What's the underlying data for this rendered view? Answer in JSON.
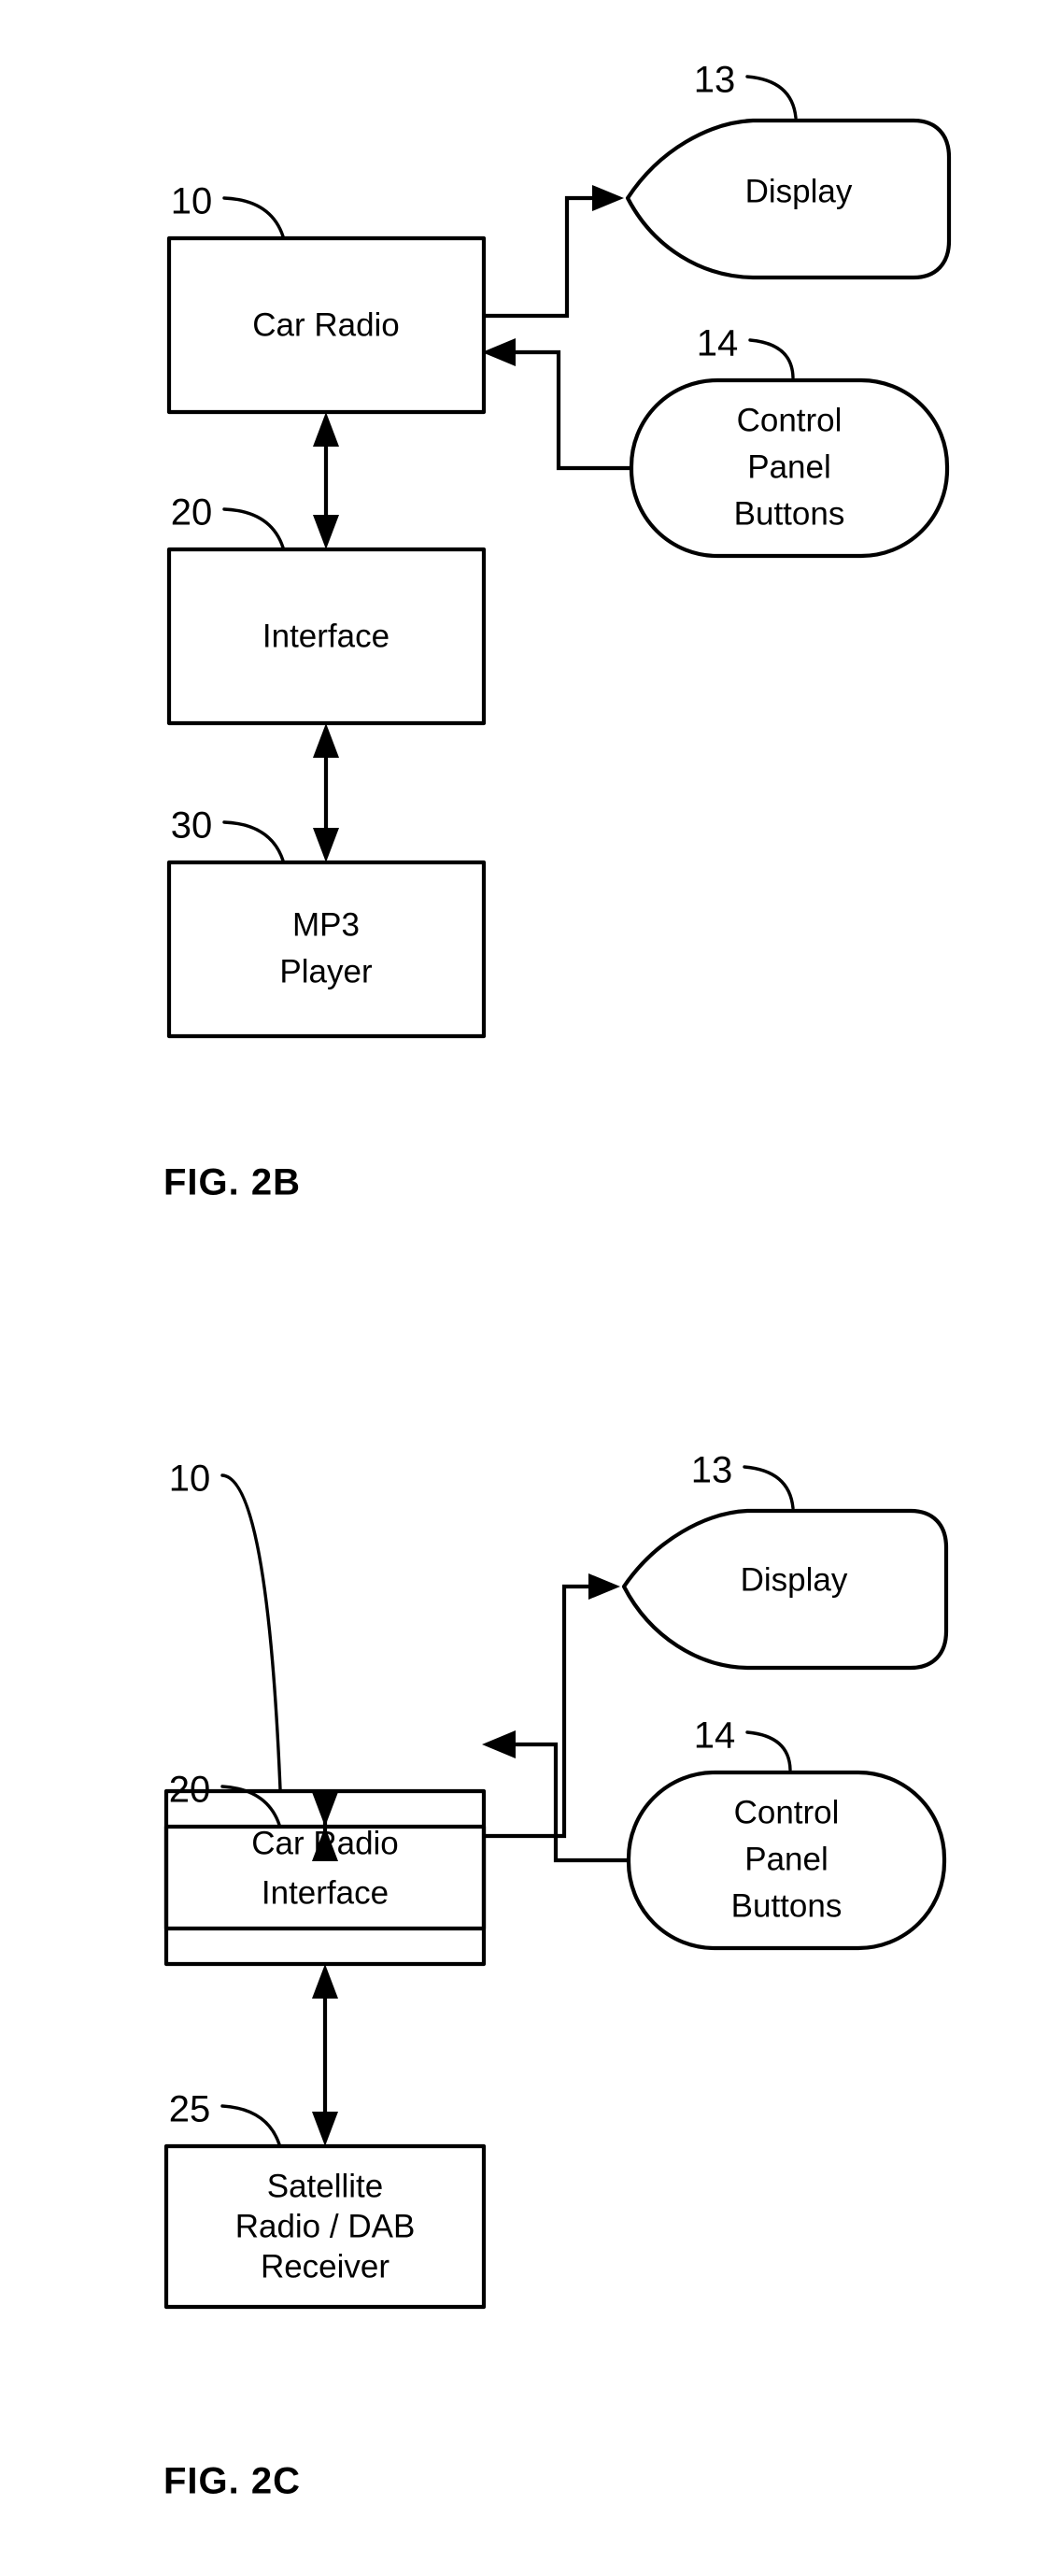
{
  "document": {
    "type": "patent-drawing-sheet",
    "background_color": "#ffffff",
    "ink_color": "#000000",
    "figure_count": 2
  },
  "figures": [
    {
      "id": "fig-2b",
      "caption": "FIG. 2B",
      "nodes": [
        {
          "key": "car_radio",
          "label": "Car Radio",
          "ref": "10",
          "shape": "rectangle"
        },
        {
          "key": "display",
          "label": "Display",
          "ref": "13",
          "shape": "teardrop"
        },
        {
          "key": "control_panel",
          "label_lines": [
            "Control",
            "Panel",
            "Buttons"
          ],
          "ref": "14",
          "shape": "rounded-rectangle"
        },
        {
          "key": "interface",
          "label": "Interface",
          "ref": "20",
          "shape": "rectangle"
        },
        {
          "key": "mp3_player",
          "label_lines": [
            "MP3",
            "Player"
          ],
          "ref": "30",
          "shape": "rectangle"
        }
      ],
      "connections": [
        {
          "from": "car_radio",
          "to": "display",
          "direction": "one-way"
        },
        {
          "from": "control_panel",
          "to": "car_radio",
          "direction": "one-way"
        },
        {
          "from": "car_radio",
          "to": "interface",
          "direction": "two-way"
        },
        {
          "from": "interface",
          "to": "mp3_player",
          "direction": "two-way"
        }
      ]
    },
    {
      "id": "fig-2c",
      "caption": "FIG. 2C",
      "nodes": [
        {
          "key": "car_radio",
          "label": "Car Radio",
          "ref": "10",
          "shape": "rectangle"
        },
        {
          "key": "display",
          "label": "Display",
          "ref": "13",
          "shape": "teardrop"
        },
        {
          "key": "control_panel",
          "label_lines": [
            "Control",
            "Panel",
            "Buttons"
          ],
          "ref": "14",
          "shape": "rounded-rectangle"
        },
        {
          "key": "interface",
          "label": "Interface",
          "ref": "20",
          "shape": "rectangle"
        },
        {
          "key": "satellite",
          "label_lines": [
            "Satellite",
            "Radio / DAB",
            "Receiver"
          ],
          "ref": "25",
          "shape": "rectangle"
        }
      ],
      "connections": [
        {
          "from": "car_radio",
          "to": "display",
          "direction": "one-way"
        },
        {
          "from": "control_panel",
          "to": "car_radio",
          "direction": "one-way"
        },
        {
          "from": "car_radio",
          "to": "interface",
          "direction": "two-way"
        },
        {
          "from": "interface",
          "to": "satellite",
          "direction": "two-way"
        }
      ]
    }
  ],
  "fig2b": {
    "caption": "FIG. 2B",
    "car_radio_label": "Car Radio",
    "car_radio_ref": "10",
    "display_label": "Display",
    "display_ref": "13",
    "control_ref": "14",
    "control_line1": "Control",
    "control_line2": "Panel",
    "control_line3": "Buttons",
    "interface_label": "Interface",
    "interface_ref": "20",
    "mp3_ref": "30",
    "mp3_line1": "MP3",
    "mp3_line2": "Player"
  },
  "fig2c": {
    "caption": "FIG. 2C",
    "car_radio_label": "Car Radio",
    "car_radio_ref": "10",
    "display_label": "Display",
    "display_ref": "13",
    "control_ref": "14",
    "control_line1": "Control",
    "control_line2": "Panel",
    "control_line3": "Buttons",
    "interface_label": "Interface",
    "interface_ref": "20",
    "satellite_ref": "25",
    "satellite_line1": "Satellite",
    "satellite_line2": "Radio / DAB",
    "satellite_line3": "Receiver"
  }
}
